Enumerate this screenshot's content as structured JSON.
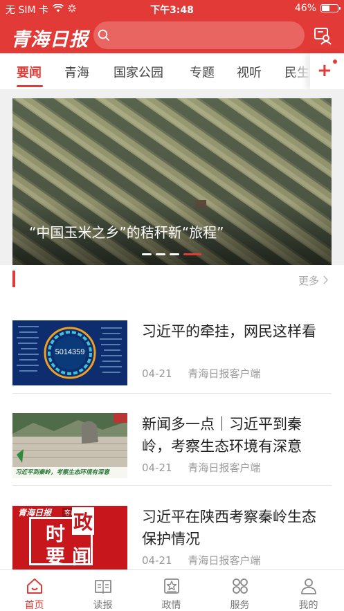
{
  "status_bar": {
    "carrier": "无 SIM 卡",
    "time": "下午3:48",
    "battery": "46%",
    "battery_level": 0.46
  },
  "header": {
    "logo": "青海日报",
    "search": {
      "placeholder": "",
      "value": ""
    },
    "action_icon": "profile-card-icon"
  },
  "tabs": [
    "要闻",
    "青海",
    "国家公园",
    "专题",
    "视听",
    "民生"
  ],
  "active_tab": 0,
  "add_tab_icon": "plus-icon",
  "banner": {
    "title": "“中国玉米之乡”的秸秆新“旅程”",
    "slide_count": 4,
    "active_slide": 3
  },
  "section": {
    "more_label": "更多"
  },
  "news": [
    {
      "title": "习近平的牵挂，网民这样看",
      "date": "04-21",
      "source": "青海日报客户端",
      "thumb_text": "5014359"
    },
    {
      "title": "新闻多一点｜习近平到秦岭，考察生态环境有深意",
      "date": "04-21",
      "source": "青海日报客户端",
      "thumb_caption": "习近平到秦岭，考察生态环境有深意"
    },
    {
      "title": "习近平在陕西考察秦岭生态保护情况",
      "date": "04-21",
      "source": "青海日报客户端",
      "thumb_logo": "青海日报",
      "thumb_badge": "客户端",
      "thumb_chars": [
        "时",
        "政",
        "要",
        "闻"
      ]
    }
  ],
  "bottom_nav": [
    {
      "label": "首页",
      "icon": "home-icon"
    },
    {
      "label": "读报",
      "icon": "newspaper-icon"
    },
    {
      "label": "政情",
      "icon": "government-icon"
    },
    {
      "label": "服务",
      "icon": "grid-services-icon"
    },
    {
      "label": "我的",
      "icon": "profile-icon"
    }
  ],
  "active_nav": 0,
  "colors": {
    "brand": "#e23a36",
    "text": "#222222",
    "muted": "#999999"
  }
}
